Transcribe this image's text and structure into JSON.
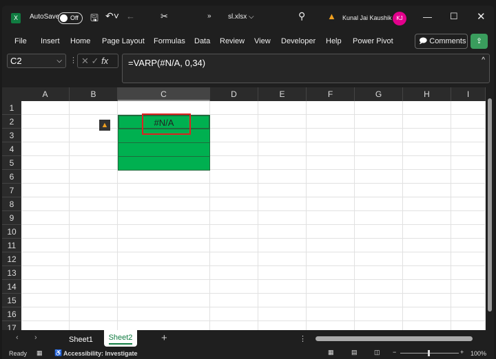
{
  "titlebar": {
    "autosave": "AutoSave",
    "toggle": "Off",
    "filename": "sl.xlsx",
    "user": "Kunal Jai Kaushik",
    "initials": "KJ",
    "avatar_color": "#e3008c"
  },
  "ribbon": {
    "tabs": [
      "File",
      "Insert",
      "Home",
      "Page Layout",
      "Formulas",
      "Data",
      "Review",
      "View",
      "Developer",
      "Help",
      "Power Pivot"
    ],
    "comments": "Comments"
  },
  "formula_bar": {
    "name_box": "C2",
    "formula": "=VARP(#N/A, 0,34)"
  },
  "grid": {
    "columns": [
      "A",
      "B",
      "C",
      "D",
      "E",
      "F",
      "G",
      "H",
      "I"
    ],
    "rows": [
      "1",
      "2",
      "3",
      "4",
      "5",
      "6",
      "7",
      "8",
      "9",
      "10",
      "11",
      "12",
      "13",
      "14",
      "15",
      "16",
      "17"
    ],
    "selected_cell": "C2",
    "cell_value": "#N/A",
    "fill_color": "#00b050",
    "highlight_color": "#e02020"
  },
  "sheets": {
    "tabs": [
      "Sheet1",
      "Sheet2"
    ],
    "active": "Sheet2"
  },
  "status": {
    "ready": "Ready",
    "accessibility": "Accessibility: Investigate",
    "zoom": "100%"
  }
}
